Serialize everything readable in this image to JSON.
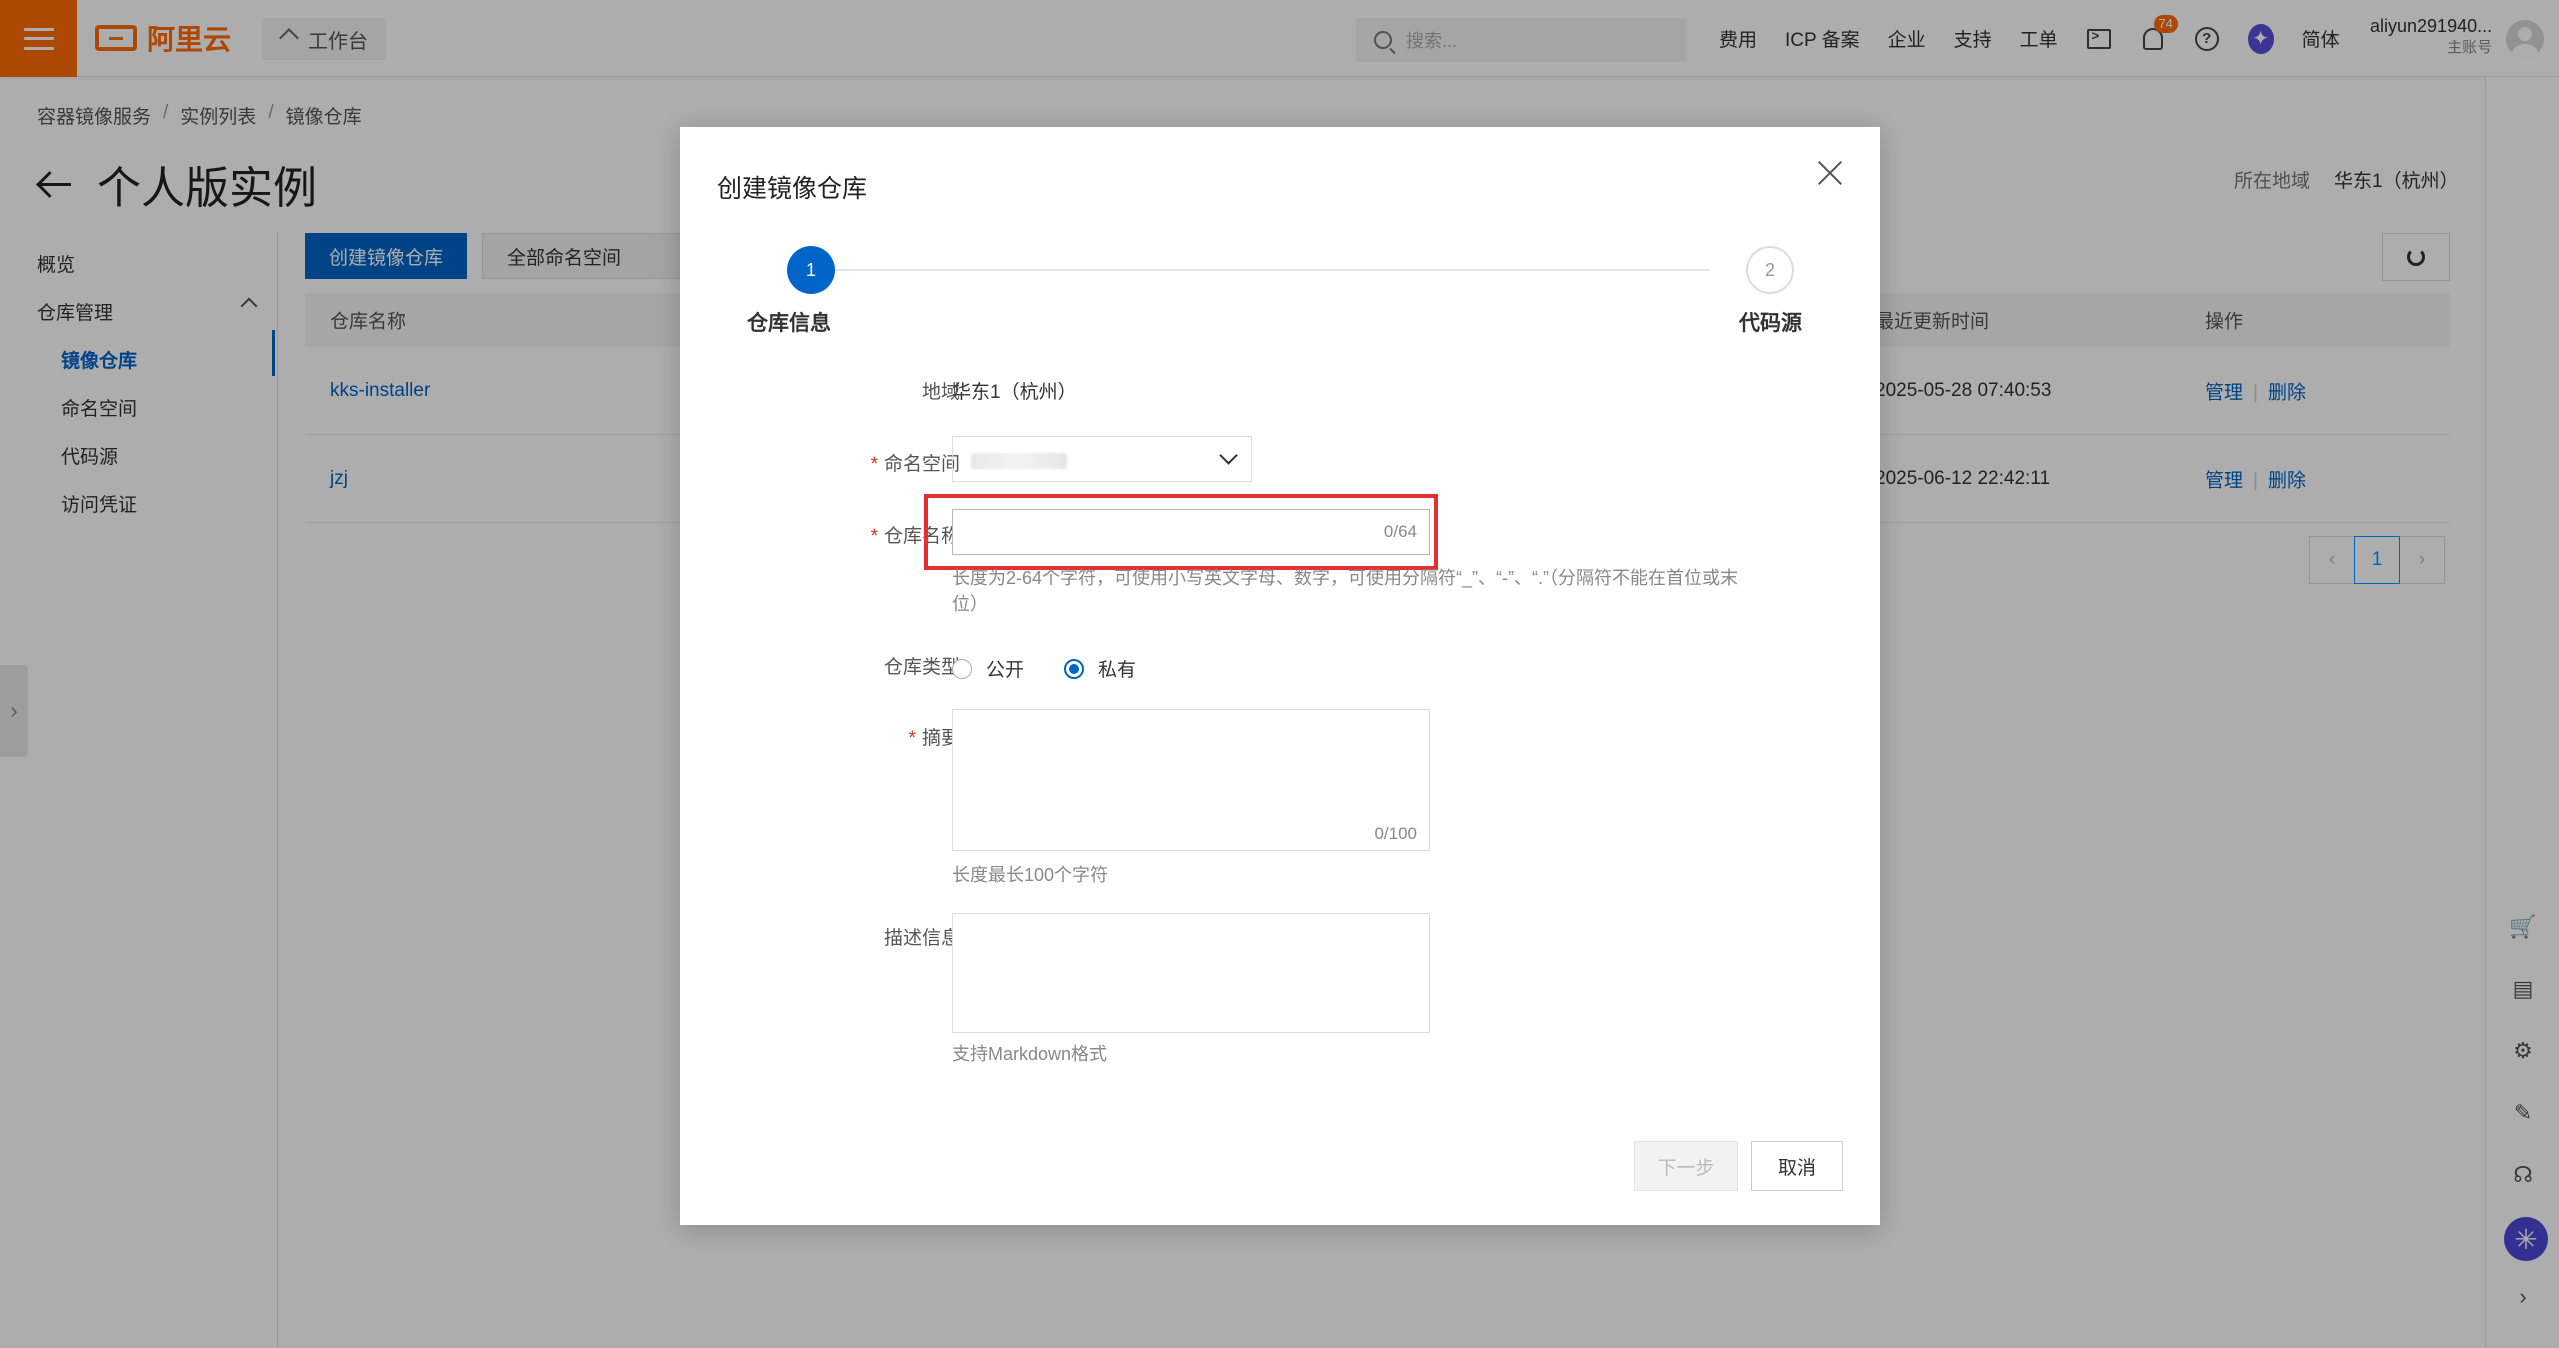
{
  "topbar": {
    "brand": "阿里云",
    "workbench": "工作台",
    "search_placeholder": "搜索...",
    "links": [
      "费用",
      "ICP 备案",
      "企业",
      "支持",
      "工单"
    ],
    "notification_count": "74",
    "language": "简体",
    "account_name": "aliyun291940...",
    "account_role": "主账号"
  },
  "breadcrumb": [
    "容器镜像服务",
    "实例列表",
    "镜像仓库"
  ],
  "page_title": "个人版实例",
  "region": {
    "label": "所在地域",
    "value": "华东1（杭州）"
  },
  "sidebar": {
    "overview": "概览",
    "repo_mgmt": "仓库管理",
    "items": [
      "镜像仓库",
      "命名空间",
      "代码源",
      "访问凭证"
    ]
  },
  "toolbar": {
    "create_button": "创建镜像仓库",
    "namespace_filter": "全部命名空间"
  },
  "table": {
    "columns": {
      "name": "仓库名称",
      "updated": "最近更新时间",
      "ops": "操作"
    },
    "rows": [
      {
        "name": "kks-installer",
        "updated": "2025-05-28 07:40:53",
        "manage": "管理",
        "delete": "删除"
      },
      {
        "name": "jzj",
        "updated": "2025-06-12 22:42:11",
        "manage": "管理",
        "delete": "删除"
      }
    ]
  },
  "pager": {
    "current": "1"
  },
  "modal": {
    "title": "创建镜像仓库",
    "steps": [
      {
        "num": "1",
        "label": "仓库信息"
      },
      {
        "num": "2",
        "label": "代码源"
      }
    ],
    "fields": {
      "region_label": "地域",
      "region_value": "华东1（杭州）",
      "namespace_label": "命名空间",
      "repo_name_label": "仓库名称",
      "repo_name_counter": "0/64",
      "repo_name_hint": "长度为2-64个字符，可使用小写英文字母、数字，可使用分隔符“_”、“-”、“.”（分隔符不能在首位或末位）",
      "repo_type_label": "仓库类型",
      "repo_type_options": [
        "公开",
        "私有"
      ],
      "repo_type_selected": "私有",
      "summary_label": "摘要",
      "summary_counter": "0/100",
      "summary_hint": "长度最长100个字符",
      "desc_label": "描述信息",
      "desc_hint": "支持Markdown格式"
    },
    "buttons": {
      "next": "下一步",
      "cancel": "取消"
    }
  },
  "colors": {
    "brand": "#ff6a00",
    "primary": "#0064c8",
    "highlight": "#e53030"
  }
}
